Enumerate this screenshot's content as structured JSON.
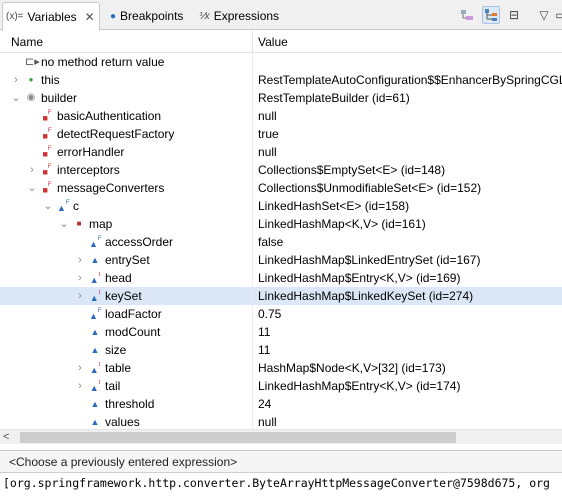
{
  "tabs": [
    {
      "label": "Variables",
      "icon": "variables-icon",
      "glyph": "(x)="
    },
    {
      "label": "Breakpoints",
      "icon": "breakpoints-icon",
      "glyph": "●"
    },
    {
      "label": "Expressions",
      "icon": "expressions-icon",
      "glyph": "⅟x"
    }
  ],
  "tab_close": "✕",
  "toolbar": {
    "collapse_glyph": "⊟",
    "minimize_glyph": "▭",
    "menu_glyph": "▽"
  },
  "header": {
    "name": "Name",
    "value": "Value"
  },
  "rows": [
    {
      "name": "no method return value",
      "value": "",
      "icon": "method-return-icon",
      "depth": 0,
      "expander": ""
    },
    {
      "name": "this",
      "value": "RestTemplateAutoConfiguration$$EnhancerBySpringCGL",
      "icon": "this-icon",
      "depth": 0,
      "expander": "›"
    },
    {
      "name": "builder",
      "value": "RestTemplateBuilder  (id=61)",
      "icon": "local-variable-icon",
      "depth": 0,
      "expander": "⌄"
    },
    {
      "name": "basicAuthentication",
      "value": "null",
      "icon": "private-final-field-icon",
      "depth": 1,
      "expander": ""
    },
    {
      "name": "detectRequestFactory",
      "value": "true",
      "icon": "private-final-field-icon",
      "depth": 1,
      "expander": ""
    },
    {
      "name": "errorHandler",
      "value": "null",
      "icon": "private-final-field-icon",
      "depth": 1,
      "expander": ""
    },
    {
      "name": "interceptors",
      "value": "Collections$EmptySet<E>  (id=148)",
      "icon": "private-final-field-icon",
      "depth": 1,
      "expander": "›"
    },
    {
      "name": "messageConverters",
      "value": "Collections$UnmodifiableSet<E>  (id=152)",
      "icon": "private-final-field-icon",
      "depth": 1,
      "expander": "⌄"
    },
    {
      "name": "c",
      "value": "LinkedHashSet<E>  (id=158)",
      "icon": "default-final-field-icon",
      "depth": 2,
      "expander": "⌄"
    },
    {
      "name": "map",
      "value": "LinkedHashMap<K,V>  (id=161)",
      "icon": "private-field-icon",
      "depth": 3,
      "expander": "⌄"
    },
    {
      "name": "accessOrder",
      "value": "false",
      "icon": "default-final-field-icon",
      "depth": 4,
      "expander": ""
    },
    {
      "name": "entrySet",
      "value": "LinkedHashMap$LinkedEntrySet  (id=167)",
      "icon": "protected-field-icon",
      "depth": 4,
      "expander": "›"
    },
    {
      "name": "head",
      "value": "LinkedHashMap$Entry<K,V>  (id=169)",
      "icon": "protected-transient-field-icon",
      "depth": 4,
      "expander": "›"
    },
    {
      "name": "keySet",
      "value": "LinkedHashMap$LinkedKeySet  (id=274)",
      "icon": "protected-transient-field-icon",
      "depth": 4,
      "expander": "›",
      "selected": true
    },
    {
      "name": "loadFactor",
      "value": "0.75",
      "icon": "default-final-field-icon",
      "depth": 4,
      "expander": ""
    },
    {
      "name": "modCount",
      "value": "11",
      "icon": "protected-field-icon",
      "depth": 4,
      "expander": ""
    },
    {
      "name": "size",
      "value": "11",
      "icon": "protected-field-icon",
      "depth": 4,
      "expander": ""
    },
    {
      "name": "table",
      "value": "HashMap$Node<K,V>[32]  (id=173)",
      "icon": "protected-transient-field-icon",
      "depth": 4,
      "expander": "›"
    },
    {
      "name": "tail",
      "value": "LinkedHashMap$Entry<K,V>  (id=174)",
      "icon": "protected-transient-field-icon",
      "depth": 4,
      "expander": "›"
    },
    {
      "name": "threshold",
      "value": "24",
      "icon": "protected-field-icon",
      "depth": 4,
      "expander": ""
    },
    {
      "name": "values",
      "value": "null",
      "icon": "protected-field-icon",
      "depth": 4,
      "expander": ""
    }
  ],
  "scroll_arrow": "<",
  "detail": {
    "expression_prompt": "<Choose a previously entered expression>",
    "value_text": "[org.springframework.http.converter.ByteArrayHttpMessageConverter@7598d675, org"
  }
}
